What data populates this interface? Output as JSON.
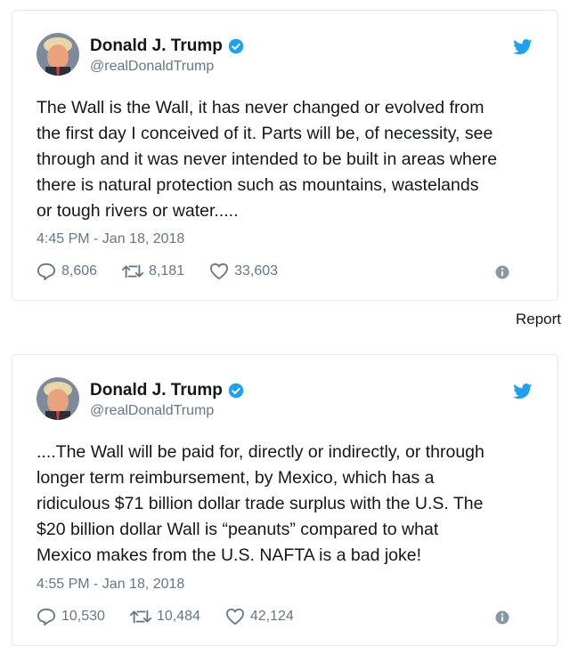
{
  "tweets": [
    {
      "author_name": "Donald J. Trump",
      "handle": "@realDonaldTrump",
      "text_lines": [
        "The Wall is the Wall, it has never changed or evolved from",
        "the first day I conceived of it. Parts will be, of necessity, see",
        "through and it was never intended to be built in areas where",
        "there is natural protection such as mountains, wastelands",
        "or tough rivers or water....."
      ],
      "timestamp": "4:45 PM - Jan 18, 2018",
      "replies": "8,606",
      "retweets": "8,181",
      "likes": "33,603",
      "icons": [
        "avatar",
        "verified-badge-icon",
        "twitter-bird-icon",
        "reply-icon",
        "retweet-icon",
        "like-icon",
        "info-icon"
      ]
    },
    {
      "author_name": "Donald J. Trump",
      "handle": "@realDonaldTrump",
      "text_lines": [
        "....The Wall will be paid for, directly or indirectly, or through",
        "longer term reimbursement, by Mexico, which has a",
        "ridiculous $71 billion dollar trade surplus with the U.S. The",
        "$20 billion dollar Wall is “peanuts” compared to what",
        "Mexico makes from the U.S. NAFTA is a bad joke!"
      ],
      "timestamp": "4:55 PM - Jan 18, 2018",
      "replies": "10,530",
      "retweets": "10,484",
      "likes": "42,124",
      "icons": [
        "avatar",
        "verified-badge-icon",
        "twitter-bird-icon",
        "reply-icon",
        "retweet-icon",
        "like-icon",
        "info-icon"
      ]
    }
  ],
  "report_label": "Report",
  "colors": {
    "twitter_blue": "#1da1f2",
    "text": "#14171a",
    "secondary": "#657786",
    "border": "#e1e8ed"
  }
}
